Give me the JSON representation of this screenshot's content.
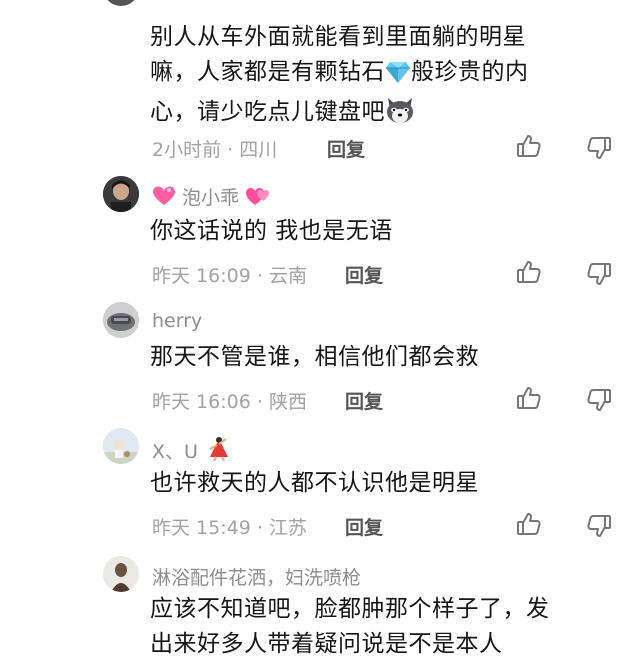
{
  "comments": [
    {
      "text_line1": "别人从车外面就能看到里面躺的明星",
      "text_line2a": "嘛，人家都是有颗钻石",
      "text_line2b": "般珍贵的内",
      "text_line3": "心，请少吃点儿键盘吧",
      "inline_emoji_1": "diamond-icon",
      "inline_emoji_2": "husky-dog-emoji",
      "time": "2小时前",
      "location": "四川",
      "reply_label": "回复"
    },
    {
      "username": "泡小乖",
      "username_emoji": "heart-icon",
      "text": "你这话说的 我也是无语",
      "time": "昨天 16:09",
      "location": "云南",
      "reply_label": "回复"
    },
    {
      "username": "herry",
      "text": "那天不管是谁，相信他们都会救",
      "time": "昨天 16:06",
      "location": "陕西",
      "reply_label": "回复"
    },
    {
      "username": "X、U",
      "username_emoji": "dancer-emoji",
      "text": "也许救天的人都不认识他是明星",
      "time": "昨天 15:49",
      "location": "江苏",
      "reply_label": "回复"
    },
    {
      "username": "淋浴配件花洒，妇洗喷枪",
      "text_line1": "应该不知道吧，脸都肿那个样子了，发",
      "text_line2": "出来好多人带着疑问说是不是本人"
    }
  ],
  "separator": "·",
  "icons": {
    "like": "thumbs-up-icon",
    "dislike": "thumbs-down-icon"
  },
  "colors": {
    "text": "#161616",
    "meta": "#a3a3a3",
    "username": "#8e8e8e",
    "reply": "#555555"
  }
}
